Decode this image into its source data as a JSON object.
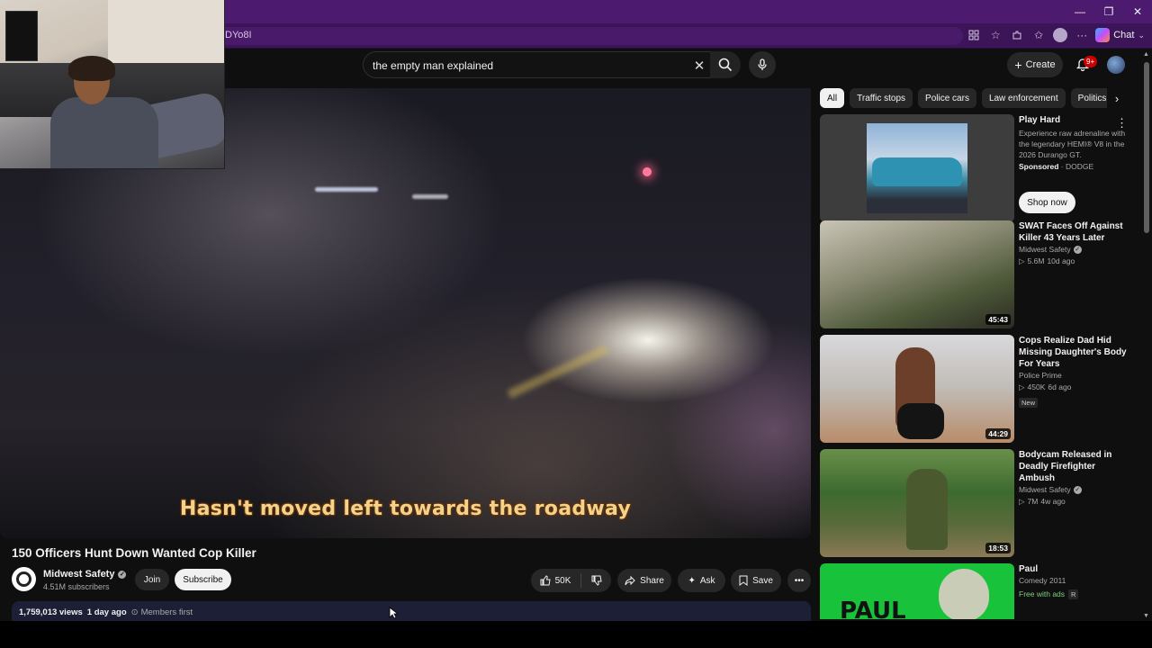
{
  "browser": {
    "url_fragment": "DYo8I",
    "copilot_label": "Chat",
    "window_controls": [
      "—",
      "❐",
      "✕"
    ]
  },
  "header": {
    "search_query": "the empty man explained",
    "create_label": "Create",
    "notification_badge": "9+"
  },
  "video": {
    "caption": "Hasn't moved left towards the roadway",
    "title": "150 Officers Hunt Down Wanted Cop Killer",
    "channel_name": "Midwest Safety",
    "subscribers": "4.51M subscribers",
    "join_label": "Join",
    "subscribe_label": "Subscribe",
    "likes": "50K",
    "share_label": "Share",
    "ask_label": "Ask",
    "save_label": "Save",
    "views": "1,759,013 views",
    "age": "1 day ago",
    "members": "Members first"
  },
  "chips": [
    "All",
    "Traffic stops",
    "Police cars",
    "Law enforcement",
    "Politics"
  ],
  "recommendations": [
    {
      "type": "ad",
      "title": "Play Hard",
      "description": "Experience raw adrenaline with the legendary HEMI® V8 in the 2026 Durango GT.",
      "sponsored_label": "Sponsored",
      "advertiser": "DODGE",
      "cta": "Shop now"
    },
    {
      "title": "SWAT Faces Off Against Killer 43 Years Later",
      "channel": "Midwest Safety",
      "views": "5.6M",
      "age": "10d ago",
      "duration": "45:43"
    },
    {
      "title": "Cops Realize Dad Hid Missing Daughter's Body For Years",
      "channel": "Police Prime",
      "views": "450K",
      "age": "6d ago",
      "badge": "New",
      "duration": "44:29"
    },
    {
      "title": "Bodycam Released in Deadly Firefighter Ambush",
      "channel": "Midwest Safety",
      "views": "7M",
      "age": "4w ago",
      "duration": "18:53"
    },
    {
      "title": "Paul",
      "meta": "Comedy 2011",
      "free_label": "Free with ads",
      "rating": "R",
      "thumb_text": "PAUL"
    }
  ],
  "colors": {
    "titlebar": "#4c1b70",
    "background": "#0f0f0f",
    "notification_red": "#cc0000",
    "caption": "#f4d28a"
  }
}
